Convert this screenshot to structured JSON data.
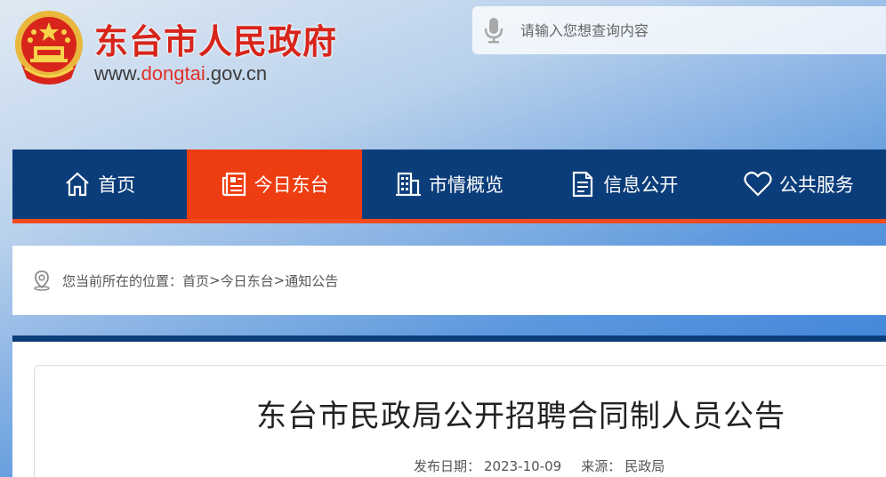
{
  "header": {
    "title": "东台市人民政府",
    "url_prefix": "www.",
    "url_domain": "dongtai",
    "url_suffix": ".gov.cn",
    "emblem_icon": "national-emblem-icon"
  },
  "search": {
    "placeholder": "请输入您想查询内容",
    "icon": "microphone-icon"
  },
  "nav": {
    "items": [
      {
        "label": "首页",
        "icon": "home-icon",
        "active": false
      },
      {
        "label": "今日东台",
        "icon": "newspaper-icon",
        "active": true
      },
      {
        "label": "市情概览",
        "icon": "building-icon",
        "active": false
      },
      {
        "label": "信息公开",
        "icon": "document-icon",
        "active": false
      },
      {
        "label": "公共服务",
        "icon": "heart-icon",
        "active": false
      }
    ],
    "active_color": "#ee3d10",
    "bg_color": "#0b3d7a"
  },
  "breadcrumb": {
    "prefix": "您当前所在的位置：",
    "items": [
      "首页",
      "今日东台",
      "通知公告"
    ],
    "separator": ">"
  },
  "article": {
    "title": "东台市民政局公开招聘合同制人员公告",
    "date_label": "发布日期：",
    "date": "2023-10-09",
    "source_label": "来源：",
    "source": "民政局"
  }
}
